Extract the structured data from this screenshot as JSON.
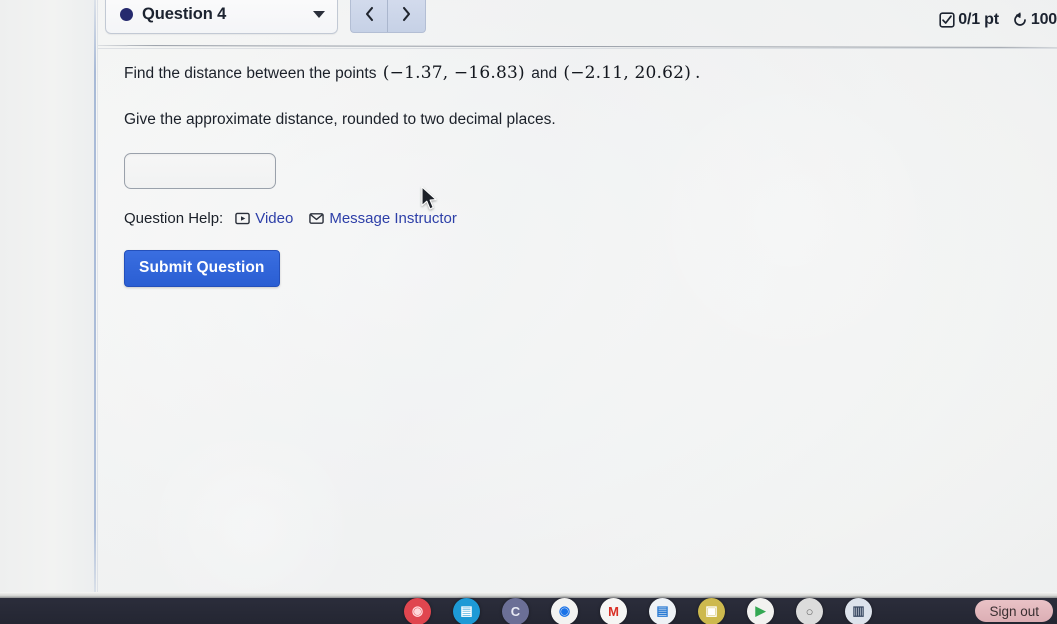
{
  "header": {
    "question_selector_label": "Question 4",
    "caret_icon": "chevron-down-icon",
    "status_dot_color": "#262a6e",
    "prev_label": "‹",
    "next_label": "›",
    "points": "0/1 pt",
    "attempts": "100",
    "points_icon": "checkbox-checked-icon",
    "attempts_icon": "retry-circular-arrow-icon"
  },
  "question": {
    "prompt_prefix": "Find the distance between the points",
    "point_a": "(−1.37, −16.83)",
    "conjunction": "and",
    "point_b": "(−2.11, 20.62)",
    "period": ".",
    "instruction": "Give the approximate distance, rounded to two decimal places."
  },
  "answer": {
    "value": "",
    "placeholder": ""
  },
  "help": {
    "label": "Question Help:",
    "video_label": "Video",
    "video_icon": "play-video-icon",
    "message_label": "Message Instructor",
    "message_icon": "envelope-icon",
    "link_color": "#2d3fa8"
  },
  "submit": {
    "label": "Submit Question",
    "color": "#2a5ed3"
  },
  "shelf": {
    "sign_out_label": "Sign out",
    "apps": [
      {
        "name": "screencast-recorder-icon",
        "glyph": "◉",
        "bg": "#e0464f",
        "fg": "#ffd9db"
      },
      {
        "name": "slides-presentation-icon",
        "glyph": "▤",
        "bg": "#1d9ad6",
        "fg": "#ffffff"
      },
      {
        "name": "clever-portal-icon",
        "glyph": "C",
        "bg": "#6b6f96",
        "fg": "#e8eaf4"
      },
      {
        "name": "chrome-browser-icon",
        "glyph": "◉",
        "bg": "#f3f3f1",
        "fg": "#1a73e8"
      },
      {
        "name": "gmail-icon",
        "glyph": "M",
        "bg": "#f6f6f4",
        "fg": "#d93025"
      },
      {
        "name": "google-docs-icon",
        "glyph": "▤",
        "bg": "#eef2f6",
        "fg": "#2a7bd4"
      },
      {
        "name": "google-classroom-icon",
        "glyph": "▣",
        "bg": "#cdb94e",
        "fg": "#ffffff"
      },
      {
        "name": "play-store-icon",
        "glyph": "▶",
        "bg": "#f2f2f0",
        "fg": "#34a853"
      },
      {
        "name": "calculator-app-icon",
        "glyph": "○",
        "bg": "#dcdcdc",
        "fg": "#6b6b6b"
      },
      {
        "name": "notes-app-icon",
        "glyph": "▥",
        "bg": "#dde3ec",
        "fg": "#3b4a63"
      }
    ]
  }
}
